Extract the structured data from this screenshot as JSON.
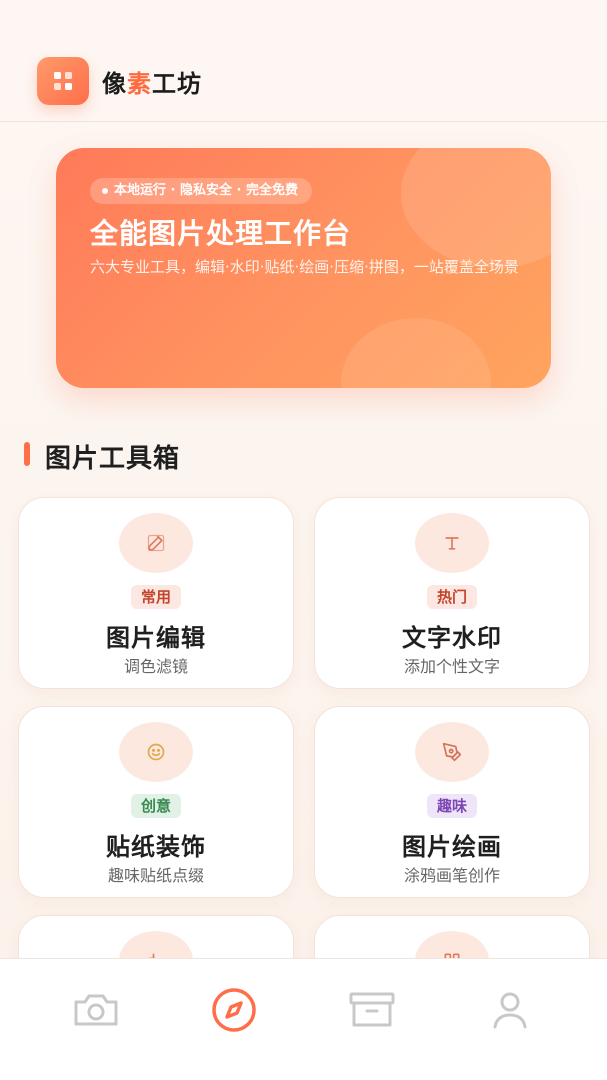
{
  "app": {
    "title_part1": "像",
    "title_accent": "素",
    "title_part2": "工坊"
  },
  "hero": {
    "badge": "本地运行 · 隐私安全 · 完全免费",
    "title": "全能图片处理工作台",
    "description": "六大专业工具，编辑·水印·贴纸·绘画·压缩·拼图，一站覆盖全场景"
  },
  "section": {
    "title": "图片工具箱"
  },
  "tools": [
    {
      "tag": "常用",
      "title": "图片编辑",
      "subtitle": "调色滤镜",
      "icon": "edit-icon"
    },
    {
      "tag": "热门",
      "title": "文字水印",
      "subtitle": "添加个性文字",
      "icon": "text-icon"
    },
    {
      "tag": "创意",
      "title": "贴纸装饰",
      "subtitle": "趣味贴纸点缀",
      "icon": "smile-icon"
    },
    {
      "tag": "趣味",
      "title": "图片绘画",
      "subtitle": "涂鸦画笔创作",
      "icon": "pen-tool-icon"
    }
  ],
  "nav": [
    {
      "icon": "camera-icon",
      "active": false
    },
    {
      "icon": "compass-icon",
      "active": true
    },
    {
      "icon": "archive-icon",
      "active": false
    },
    {
      "icon": "user-icon",
      "active": false
    }
  ],
  "colors": {
    "accent": "#ff6a3d",
    "nav_active": "#ff6e4a",
    "nav_inactive": "#c8c8c8"
  }
}
